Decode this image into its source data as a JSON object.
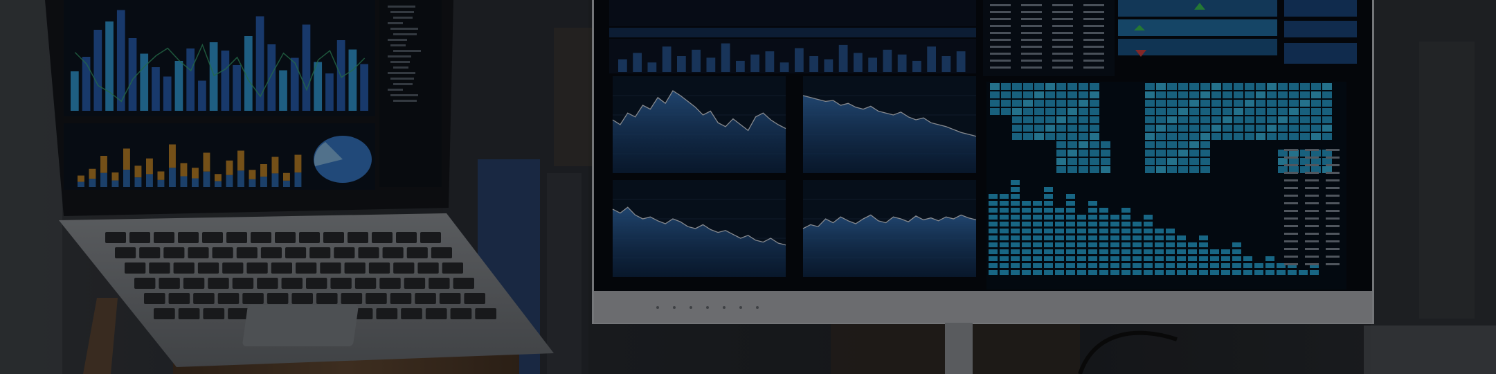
{
  "scene": {
    "description_free": true,
    "palette": {
      "background_dark": "#0b0f16",
      "wall": "#2a2d33",
      "screen_bg": "#0a1220",
      "chart_blue": "#2f6fb8",
      "chart_cyan": "#35b7e8",
      "chart_orange": "#c98a2a",
      "map_cyan": "#2aa6d8",
      "bezel_silver": "#8b8f94",
      "wood": "#5a4330",
      "overlay": "rgba(0,0,0,0.42)"
    },
    "laptop": {
      "bar_levels_top": [
        0.38,
        0.52,
        0.78,
        0.86,
        0.97,
        0.7,
        0.55,
        0.42,
        0.33,
        0.48,
        0.6,
        0.29,
        0.66,
        0.58,
        0.44,
        0.72,
        0.91,
        0.64,
        0.39,
        0.51,
        0.83,
        0.47,
        0.36,
        0.68,
        0.59,
        0.45
      ],
      "bar_levels_bottom": [
        0.22,
        0.35,
        0.6,
        0.28,
        0.74,
        0.41,
        0.55,
        0.3,
        0.82,
        0.46,
        0.37,
        0.66,
        0.25,
        0.51,
        0.7,
        0.33,
        0.44,
        0.58,
        0.27,
        0.62
      ]
    },
    "monitor": {
      "area_series_a": [
        0.55,
        0.5,
        0.62,
        0.58,
        0.7,
        0.66,
        0.78,
        0.72,
        0.85,
        0.8,
        0.74,
        0.68,
        0.6,
        0.64,
        0.52,
        0.48,
        0.56,
        0.5,
        0.44,
        0.58,
        0.62,
        0.55,
        0.5,
        0.46
      ],
      "area_series_b": [
        0.8,
        0.78,
        0.76,
        0.74,
        0.75,
        0.7,
        0.72,
        0.68,
        0.66,
        0.69,
        0.64,
        0.62,
        0.6,
        0.63,
        0.58,
        0.55,
        0.57,
        0.52,
        0.5,
        0.48,
        0.45,
        0.42,
        0.4,
        0.38
      ],
      "area_series_c": [
        0.7,
        0.66,
        0.72,
        0.64,
        0.6,
        0.62,
        0.58,
        0.55,
        0.6,
        0.57,
        0.52,
        0.5,
        0.54,
        0.49,
        0.46,
        0.48,
        0.44,
        0.4,
        0.43,
        0.38,
        0.36,
        0.4,
        0.35,
        0.33
      ],
      "area_series_d": [
        0.5,
        0.54,
        0.52,
        0.6,
        0.56,
        0.62,
        0.58,
        0.55,
        0.6,
        0.64,
        0.58,
        0.56,
        0.62,
        0.6,
        0.57,
        0.63,
        0.59,
        0.61,
        0.58,
        0.62,
        0.6,
        0.64,
        0.61,
        0.59
      ],
      "mini_bar_levels": [
        0.4,
        0.6,
        0.3,
        0.8,
        0.5,
        0.7,
        0.45,
        0.9,
        0.35,
        0.55,
        0.65,
        0.3,
        0.75,
        0.5,
        0.4,
        0.85,
        0.6,
        0.45,
        0.7,
        0.55,
        0.35,
        0.8,
        0.5,
        0.65
      ],
      "equalizer_levels": [
        0.72,
        0.68,
        0.8,
        0.66,
        0.62,
        0.75,
        0.58,
        0.7,
        0.54,
        0.64,
        0.6,
        0.5,
        0.56,
        0.46,
        0.52,
        0.4,
        0.44,
        0.36,
        0.3,
        0.34,
        0.26,
        0.22,
        0.28,
        0.18,
        0.14,
        0.2,
        0.12,
        0.1,
        0.08,
        0.09
      ]
    }
  }
}
